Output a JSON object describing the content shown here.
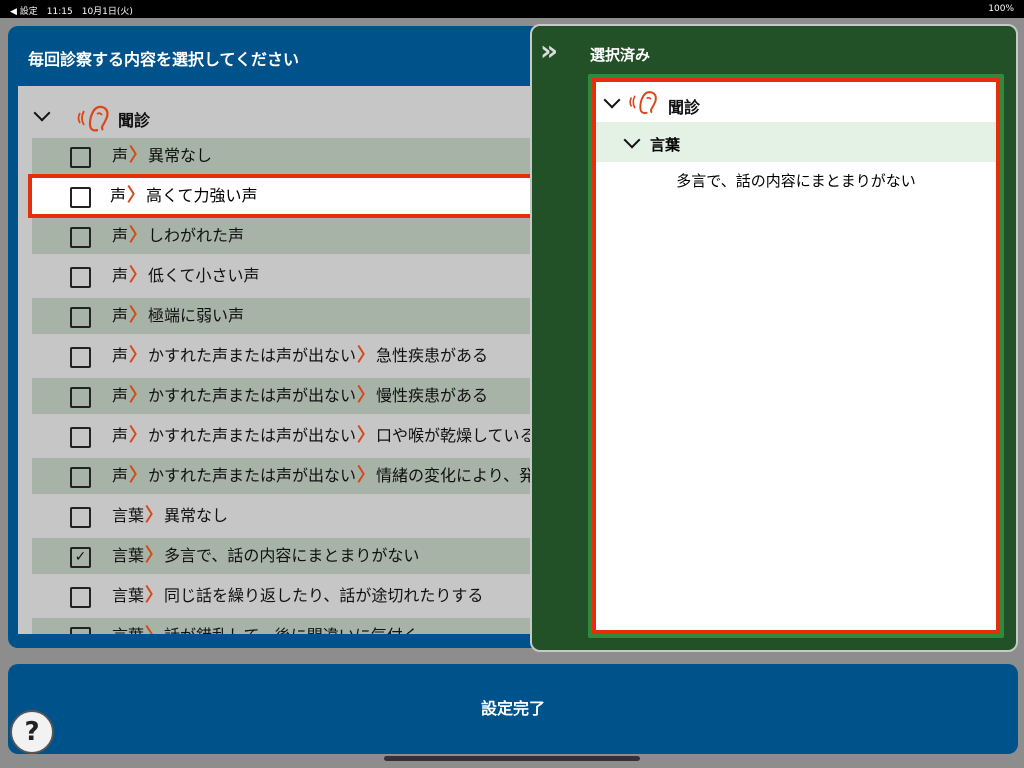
{
  "status_bar": {
    "left": "◀ 設定　11:15　10月1日(火)",
    "right": "100%"
  },
  "left_panel": {
    "title": "毎回診察する内容を選択してください",
    "group": "聞診",
    "rows": [
      {
        "segments": [
          "声",
          "異常なし"
        ],
        "checked": false
      },
      {
        "segments": [
          "声",
          "高くて力強い声"
        ],
        "checked": false,
        "highlighted": true
      },
      {
        "segments": [
          "声",
          "しわがれた声"
        ],
        "checked": false
      },
      {
        "segments": [
          "声",
          "低くて小さい声"
        ],
        "checked": false
      },
      {
        "segments": [
          "声",
          "極端に弱い声"
        ],
        "checked": false
      },
      {
        "segments": [
          "声",
          "かすれた声または声が出ない",
          "急性疾患がある"
        ],
        "checked": false
      },
      {
        "segments": [
          "声",
          "かすれた声または声が出ない",
          "慢性疾患がある"
        ],
        "checked": false
      },
      {
        "segments": [
          "声",
          "かすれた声または声が出ない",
          "口や喉が乾燥している"
        ],
        "checked": false
      },
      {
        "segments": [
          "声",
          "かすれた声または声が出ない",
          "情緒の変化により、発生"
        ],
        "checked": false
      },
      {
        "segments": [
          "言葉",
          "異常なし"
        ],
        "checked": false
      },
      {
        "segments": [
          "言葉",
          "多言で、話の内容にまとまりがない"
        ],
        "checked": true
      },
      {
        "segments": [
          "言葉",
          "同じ話を繰り返したり、話が途切れたりする"
        ],
        "checked": false
      },
      {
        "segments": [
          "言葉",
          "話が錯乱して、後に間違いに気付く"
        ],
        "checked": false
      }
    ]
  },
  "right_panel": {
    "title": "選択済み",
    "group": "聞診",
    "subgroup": "言葉",
    "items": [
      "多言で、話の内容にまとまりがない"
    ]
  },
  "bottom": {
    "done_label": "設定完了",
    "help_label": "?"
  },
  "colors": {
    "blue": "#00528a",
    "green": "#225027",
    "highlight": "#e52f0c",
    "accent_arrow": "#d9471b"
  },
  "icons": {
    "collapse": "double-chevron-right-icon",
    "group": "ear-icon",
    "expand": "chevron-down-icon"
  }
}
